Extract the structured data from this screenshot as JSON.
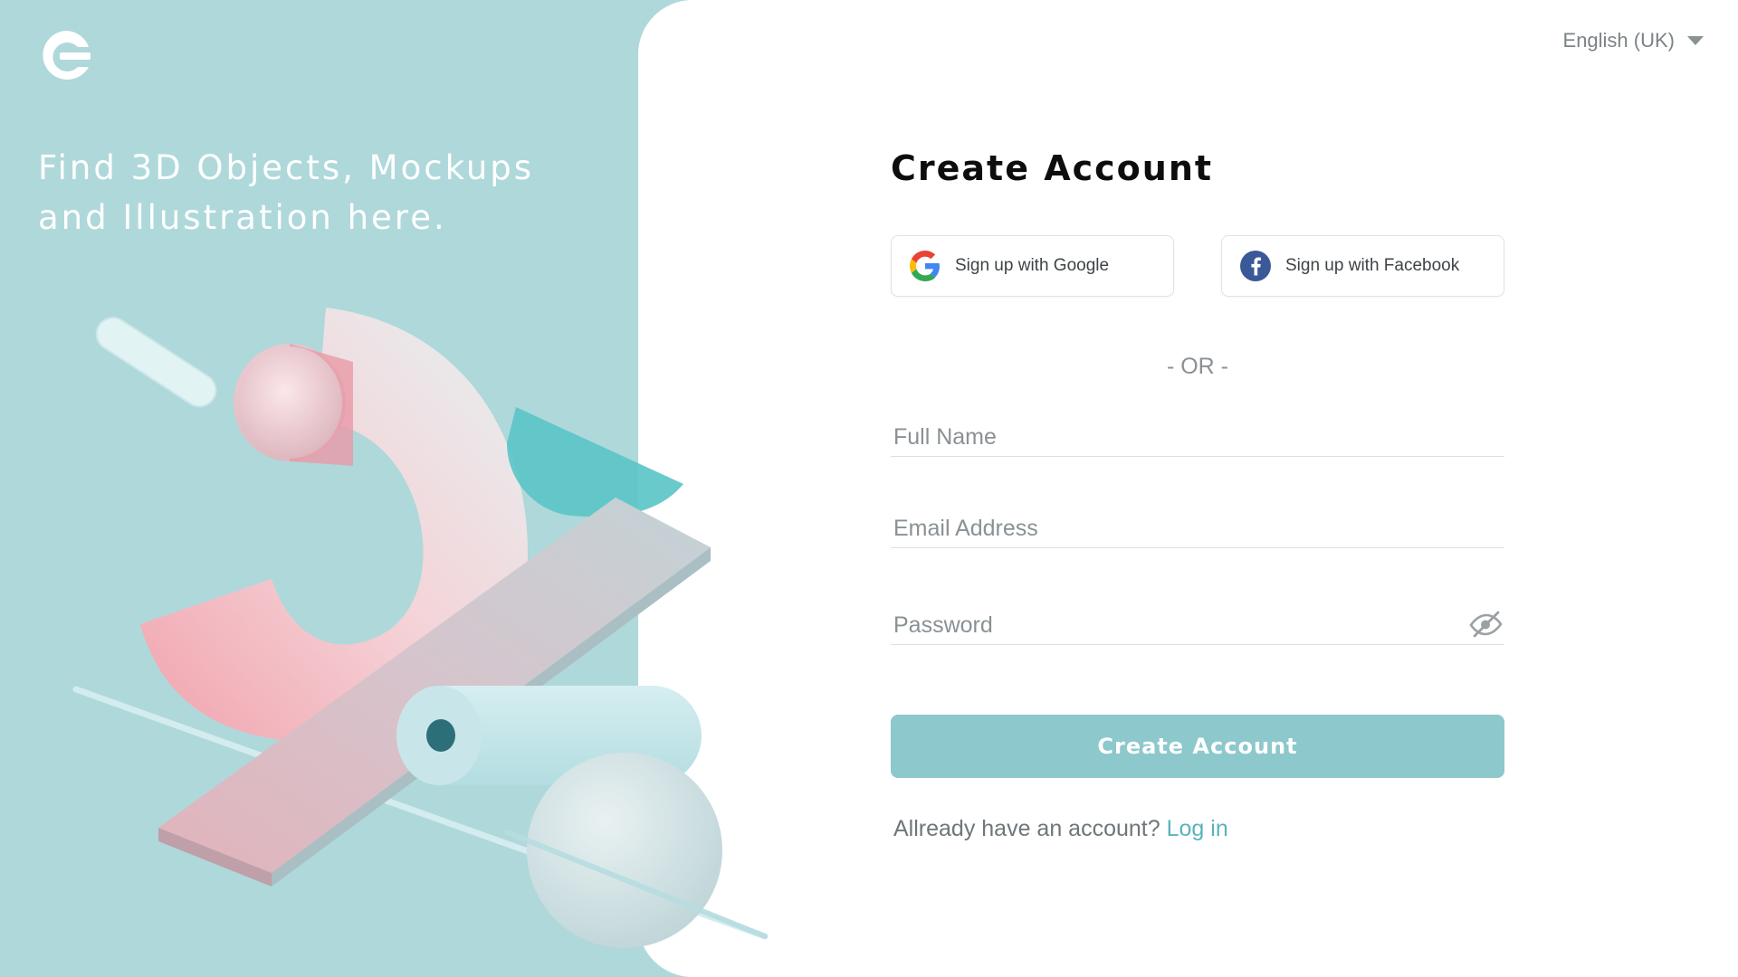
{
  "brand": {
    "logo_icon": "brand-c-logo-icon",
    "panel_color": "#afd8da",
    "accent_color": "#8cc8cc",
    "link_color": "#5ab3bb"
  },
  "hero": {
    "tagline_line1": "Find 3D Objects, Mockups",
    "tagline_line2": "and Illustration here.",
    "illustration_icon": "abstract-3d-shapes-illustration"
  },
  "language": {
    "selected": "English (UK)",
    "icon": "chevron-down-icon"
  },
  "form": {
    "title": "Create Account",
    "google_label": "Sign up with Google",
    "google_icon": "google-icon",
    "facebook_label": "Sign up with Facebook",
    "facebook_icon": "facebook-icon",
    "divider": "- OR -",
    "full_name_placeholder": "Full Name",
    "email_placeholder": "Email Address",
    "password_placeholder": "Password",
    "password_toggle_icon": "eye-off-icon",
    "submit_label": "Create Account",
    "login_prompt": "Allready have an account?",
    "login_link": "Log in"
  }
}
